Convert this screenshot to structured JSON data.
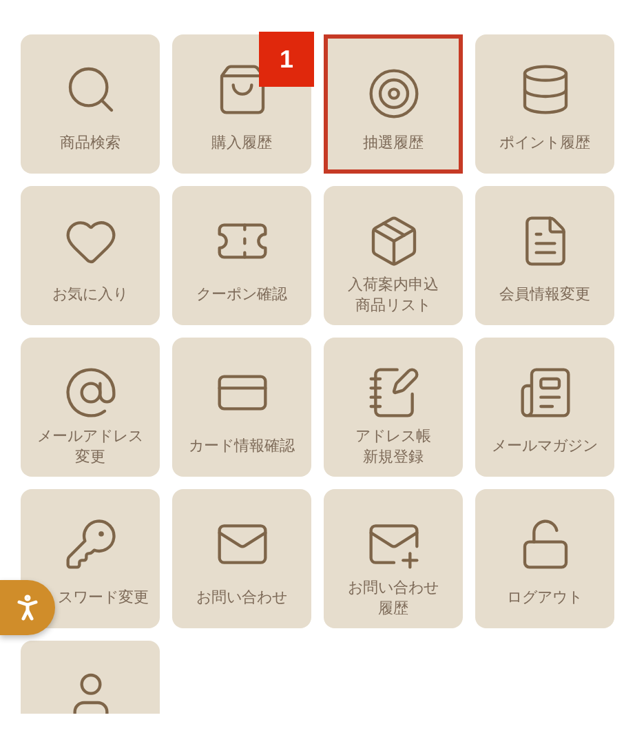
{
  "menu": [
    {
      "label": [
        "商品検索"
      ],
      "selected": false
    },
    {
      "label": [
        "購入履歴"
      ],
      "selected": false,
      "badge": "1"
    },
    {
      "label": [
        "抽選履歴"
      ],
      "selected": true
    },
    {
      "label": [
        "ポイント履歴"
      ],
      "selected": false
    },
    {
      "label": [
        "お気に入り"
      ],
      "selected": false
    },
    {
      "label": [
        "クーポン確認"
      ],
      "selected": false
    },
    {
      "label": [
        "入荷案内申込",
        "商品リスト"
      ],
      "selected": false
    },
    {
      "label": [
        "会員情報変更"
      ],
      "selected": false
    },
    {
      "label": [
        "メールアドレス",
        "変更"
      ],
      "selected": false
    },
    {
      "label": [
        "カード情報確認"
      ],
      "selected": false
    },
    {
      "label": [
        "アドレス帳",
        "新規登録"
      ],
      "selected": false
    },
    {
      "label": [
        "メールマガジン"
      ],
      "selected": false
    },
    {
      "label": [
        "スワード変更"
      ],
      "selected": false,
      "covered": true
    },
    {
      "label": [
        "お問い合わせ"
      ],
      "selected": false
    },
    {
      "label": [
        "お問い合わせ",
        "履歴"
      ],
      "selected": false
    },
    {
      "label": [
        "ログアウト"
      ],
      "selected": false
    },
    {
      "selected": false
    }
  ]
}
